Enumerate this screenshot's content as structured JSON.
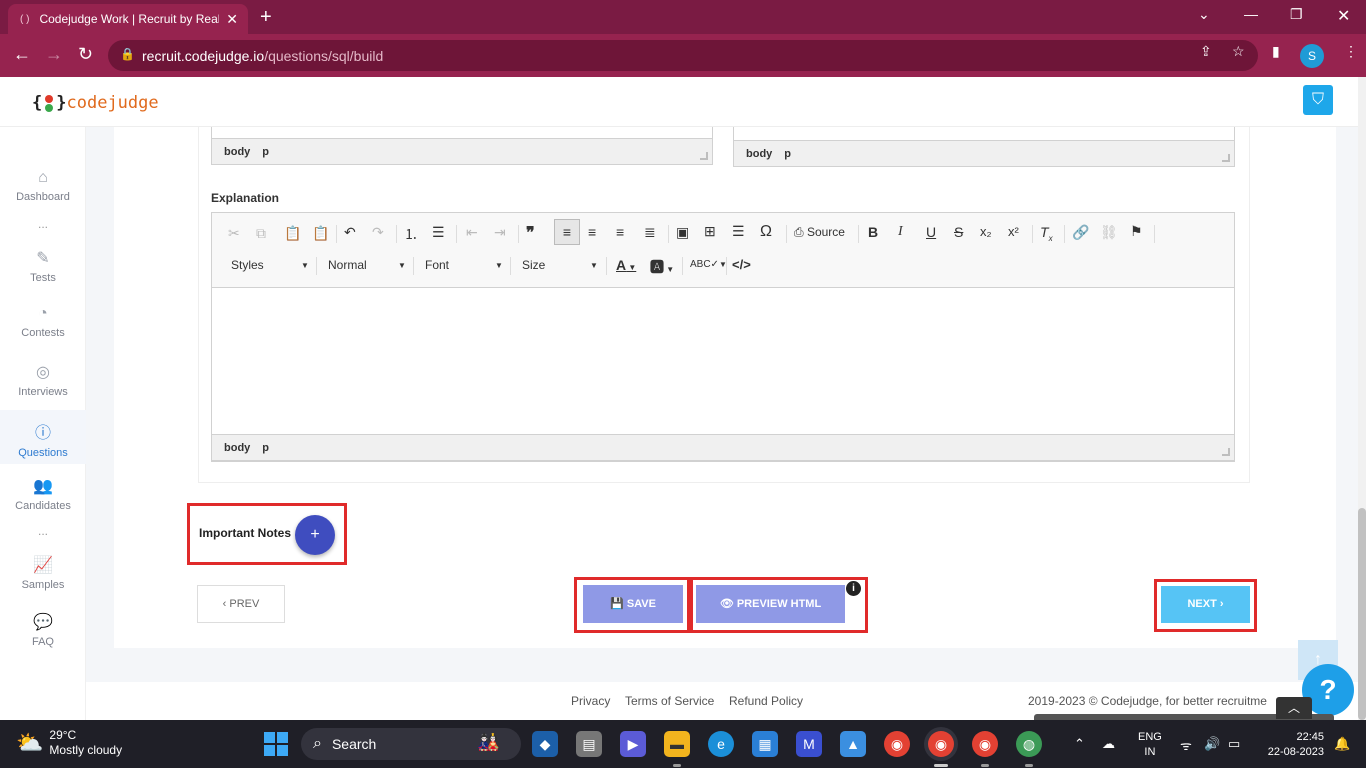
{
  "browser": {
    "tab_title": "Codejudge Work | Recruit by Real",
    "url_host": "recruit.codejudge.io",
    "url_path": "/questions/sql/build",
    "profile_initial": "S"
  },
  "header": {
    "logo_text": "codejudge",
    "logo_open": "{",
    "logo_close": "}"
  },
  "sidebar": {
    "items": [
      {
        "label": "Dashboard"
      },
      {
        "label": "Tests"
      },
      {
        "label": "Contests"
      },
      {
        "label": "Interviews"
      },
      {
        "label": "Questions"
      },
      {
        "label": "Candidates"
      },
      {
        "label": "Samples"
      },
      {
        "label": "FAQ"
      }
    ],
    "dots": "..."
  },
  "editors": {
    "top_left_path": [
      "body",
      "p"
    ],
    "top_right_path": [
      "body",
      "p"
    ],
    "explanation_label": "Explanation",
    "explanation_path": [
      "body",
      "p"
    ],
    "source_label": "Source",
    "combos": {
      "styles": "Styles",
      "format": "Normal",
      "font": "Font",
      "size": "Size"
    }
  },
  "notes": {
    "label": "Important Notes",
    "add": "+"
  },
  "actions": {
    "prev": "‹ PREV",
    "save": "SAVE",
    "preview": "PREVIEW HTML",
    "next": "NEXT ›",
    "info": "i"
  },
  "footer": {
    "privacy": "Privacy",
    "terms": "Terms of Service",
    "refund": "Refund Policy",
    "copyright": "2019-2023 ©  Codejudge, for better recruitme"
  },
  "help": "?",
  "taskbar": {
    "temp": "29°C",
    "weather": "Mostly cloudy",
    "search": "Search",
    "lang1": "ENG",
    "lang2": "IN",
    "time": "22:45",
    "date": "22-08-2023"
  },
  "colors": {
    "brand": "#96234f",
    "accent": "#2e7bd0",
    "highlight": "#e02a2a"
  }
}
